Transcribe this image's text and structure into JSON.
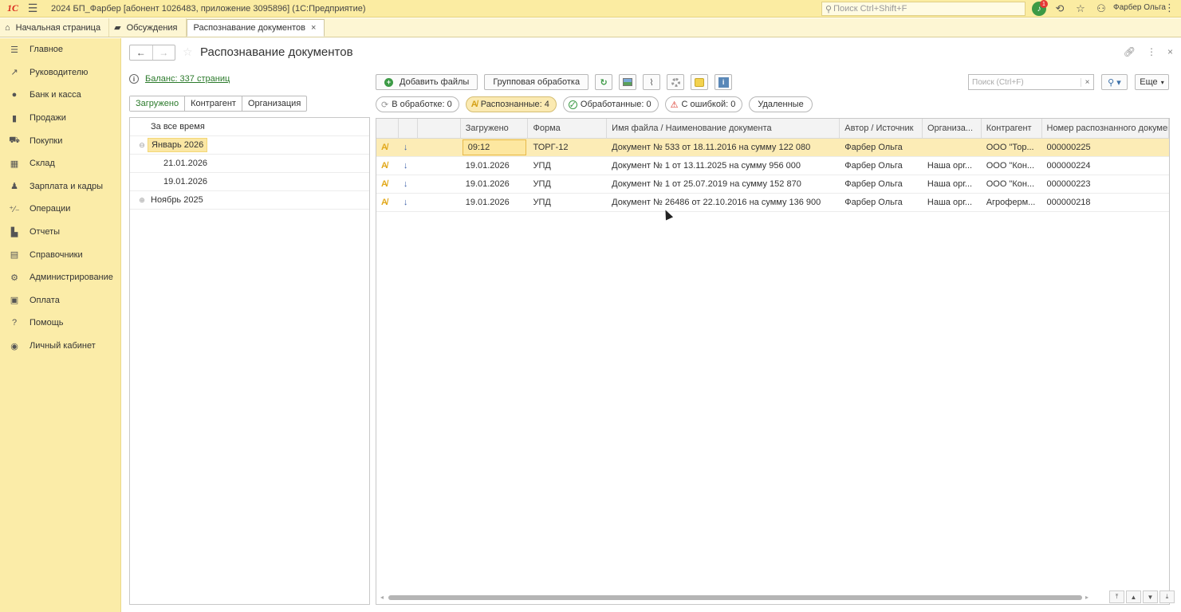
{
  "titlebar": {
    "logo": "1С",
    "app_title": "2024 БП_Фарбер [абонент 1026483, приложение 3095896]  (1С:Предприятие)",
    "search_placeholder": "Поиск Ctrl+Shift+F",
    "notification_count": "1",
    "user_name": "Фарбер Ольга"
  },
  "tabs": [
    {
      "label": "Начальная страница",
      "icon": "home-icon"
    },
    {
      "label": "Обсуждения",
      "icon": "chat-icon"
    },
    {
      "label": "Распознавание документов",
      "active": true
    }
  ],
  "sidebar": {
    "items": [
      {
        "label": "Главное",
        "icon": "menu-icon"
      },
      {
        "label": "Руководителю",
        "icon": "trend-icon"
      },
      {
        "label": "Банк и касса",
        "icon": "coin-icon"
      },
      {
        "label": "Продажи",
        "icon": "bag-icon"
      },
      {
        "label": "Покупки",
        "icon": "cart-icon"
      },
      {
        "label": "Склад",
        "icon": "warehouse-icon"
      },
      {
        "label": "Зарплата и кадры",
        "icon": "person-icon"
      },
      {
        "label": "Операции",
        "icon": "operations-icon"
      },
      {
        "label": "Отчеты",
        "icon": "chart-icon"
      },
      {
        "label": "Справочники",
        "icon": "book-icon"
      },
      {
        "label": "Администрирование",
        "icon": "gear-icon"
      },
      {
        "label": "Оплата",
        "icon": "wallet-icon"
      },
      {
        "label": "Помощь",
        "icon": "help-icon"
      },
      {
        "label": "Личный кабинет",
        "icon": "account-icon"
      }
    ]
  },
  "page": {
    "title": "Распознавание документов",
    "balance_link": "Баланс: 337 страниц"
  },
  "left_pane": {
    "segments": [
      "Загружено",
      "Контрагент",
      "Организация"
    ],
    "tree": [
      {
        "label": "За все время",
        "level": 0,
        "toggle": ""
      },
      {
        "label": "Январь 2026",
        "level": 0,
        "toggle": "⊖",
        "selected": true
      },
      {
        "label": "21.01.2026",
        "level": 1,
        "toggle": ""
      },
      {
        "label": "19.01.2026",
        "level": 1,
        "toggle": ""
      },
      {
        "label": "Ноябрь 2025",
        "level": 0,
        "toggle": "⊕"
      }
    ]
  },
  "toolbar": {
    "add_files": "Добавить файлы",
    "group_processing": "Групповая обработка",
    "search_placeholder": "Поиск (Ctrl+F)",
    "more": "Еще"
  },
  "filters": {
    "in_processing": "В обработке: 0",
    "recognized": "Распознанные: 4",
    "processed": "Обработанные: 0",
    "with_error": "С ошибкой: 0",
    "deleted": "Удаленные"
  },
  "grid": {
    "headers": [
      "",
      "",
      "",
      "Загружено",
      "Форма",
      "Имя файла / Наименование документа",
      "Автор / Источник",
      "Организа...",
      "Контрагент",
      "Номер распознанного докумен"
    ],
    "rows": [
      {
        "loaded": "09:12",
        "form": "ТОРГ-12",
        "name": "Документ № 533 от 18.11.2016 на сумму 122 080",
        "author": "Фарбер Ольга",
        "org": "",
        "contractor": "ООО \"Тор...",
        "number": "000000225"
      },
      {
        "loaded": "19.01.2026",
        "form": "УПД",
        "name": "Документ № 1 от 13.11.2025 на сумму 956 000",
        "author": "Фарбер Ольга",
        "org": "Наша орг...",
        "contractor": "ООО \"Кон...",
        "number": "000000224"
      },
      {
        "loaded": "19.01.2026",
        "form": "УПД",
        "name": "Документ № 1 от 25.07.2019 на сумму 152 870",
        "author": "Фарбер Ольга",
        "org": "Наша орг...",
        "contractor": "ООО \"Кон...",
        "number": "000000223"
      },
      {
        "loaded": "19.01.2026",
        "form": "УПД",
        "name": "Документ № 26486 от 22.10.2016 на сумму 136 900",
        "author": "Фарбер Ольга",
        "org": "Наша орг...",
        "contractor": "Агроферм...",
        "number": "000000218"
      }
    ]
  },
  "colors": {
    "header_yellow": "#fbeca2",
    "sidebar_yellow": "#fbeca8",
    "link_green": "#2b7a2b",
    "selection": "#fcecb6"
  }
}
